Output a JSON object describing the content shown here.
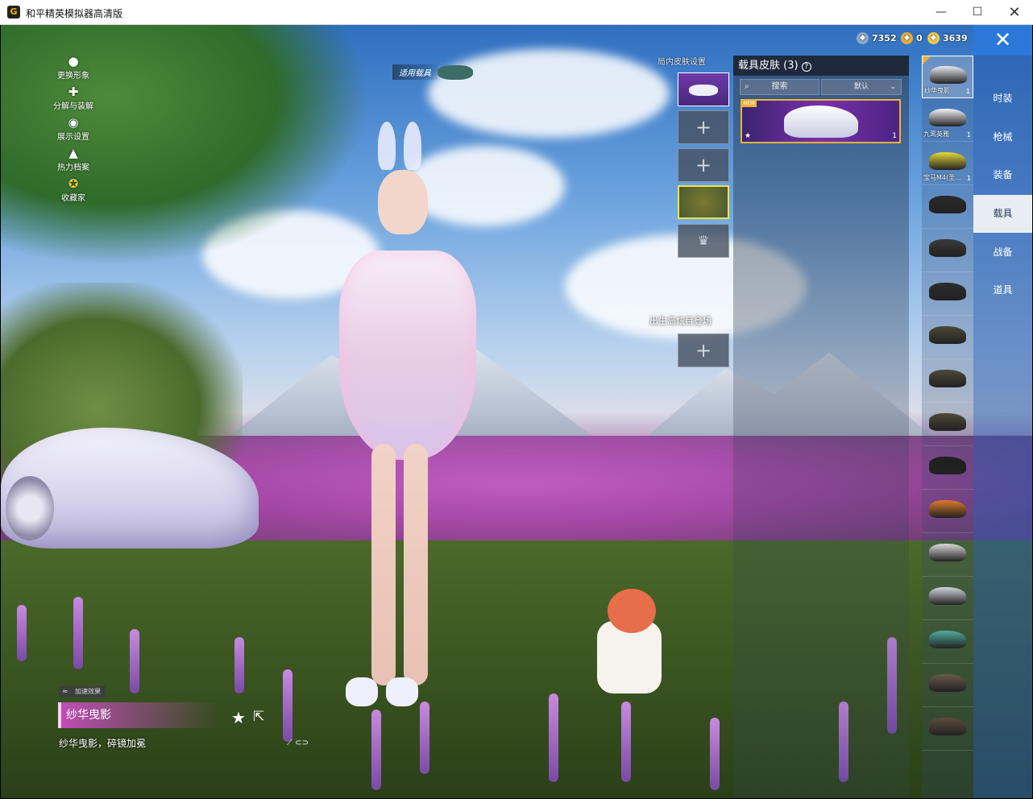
{
  "window": {
    "title": "和平精英模拟器高清版",
    "app_icon": "G",
    "minimize": "—",
    "maximize": "☐",
    "close": "✕"
  },
  "currency": [
    {
      "value": "7352",
      "color": "#8fa8c8"
    },
    {
      "value": "0",
      "color": "#e0b040"
    },
    {
      "value": "3639",
      "color": "#f2c94c"
    }
  ],
  "left_menu": [
    {
      "label": "更换形象",
      "icon": "person-icon"
    },
    {
      "label": "分解与装解",
      "icon": "puzzle-icon"
    },
    {
      "label": "展示设置",
      "icon": "eye-icon"
    },
    {
      "label": "热力档案",
      "icon": "flame-icon"
    },
    {
      "label": "收藏家",
      "icon": "collector-badge-icon"
    }
  ],
  "apply_vehicle_label": "适用载具",
  "slots": {
    "title": "局内皮肤设置",
    "spawn_title": "出生岛炫目登场",
    "add_symbol": "+",
    "crown_symbol": "♛"
  },
  "skin_panel": {
    "title": "载具皮肤 (3)",
    "help": "?",
    "search_placeholder": "搜索",
    "search_icon": "⌕",
    "sort_label": "默认",
    "sort_chevron": "⌄",
    "card_star": "★",
    "card_count": "1",
    "card_badge": "NEW"
  },
  "vehicles": [
    {
      "name": "纱华曳影",
      "count": "1",
      "color": "#e8e9f2",
      "selected": true
    },
    {
      "name": "九鸾英雅",
      "count": "1",
      "color": "#f4f4fa",
      "selected": false
    },
    {
      "name": "宝马M4(圣...",
      "count": "1",
      "color": "#e8d83a",
      "selected": false
    },
    {
      "name": "",
      "count": "",
      "color": "#2a2a2a",
      "selected": false
    },
    {
      "name": "",
      "count": "",
      "color": "#3a3a3a",
      "selected": false
    },
    {
      "name": "",
      "count": "",
      "color": "#2c2c2c",
      "selected": false
    },
    {
      "name": "",
      "count": "",
      "color": "#4b4a38",
      "selected": false
    },
    {
      "name": "",
      "count": "",
      "color": "#4a4a3a",
      "selected": false
    },
    {
      "name": "",
      "count": "",
      "color": "#4d4a36",
      "selected": false
    },
    {
      "name": "",
      "count": "",
      "color": "#1f1f1f",
      "selected": false
    },
    {
      "name": "",
      "count": "",
      "color": "#e07a2a",
      "selected": false
    },
    {
      "name": "",
      "count": "",
      "color": "#d9d9d9",
      "selected": false
    },
    {
      "name": "",
      "count": "",
      "color": "#cfd5e0",
      "selected": false
    },
    {
      "name": "",
      "count": "",
      "color": "#4fae9e",
      "selected": false
    },
    {
      "name": "",
      "count": "",
      "color": "#6a5a4a",
      "selected": false
    },
    {
      "name": "",
      "count": "",
      "color": "#5d4d3d",
      "selected": false
    }
  ],
  "categories": [
    {
      "label": "时装",
      "active": false
    },
    {
      "label": "枪械",
      "active": false
    },
    {
      "label": "装备",
      "active": false
    },
    {
      "label": "载具",
      "active": true
    },
    {
      "label": "战备",
      "active": false
    },
    {
      "label": "道具",
      "active": false
    }
  ],
  "close_x": "✕",
  "selected_skin": {
    "tag": "加速效果",
    "tag_icon": "≈",
    "name": "纱华曳影",
    "description": "纱华曳影，碎镜加冕",
    "fav_icon": "★",
    "share_icon": "⇱",
    "extra_icons": "⟋ ⊂⊃"
  }
}
